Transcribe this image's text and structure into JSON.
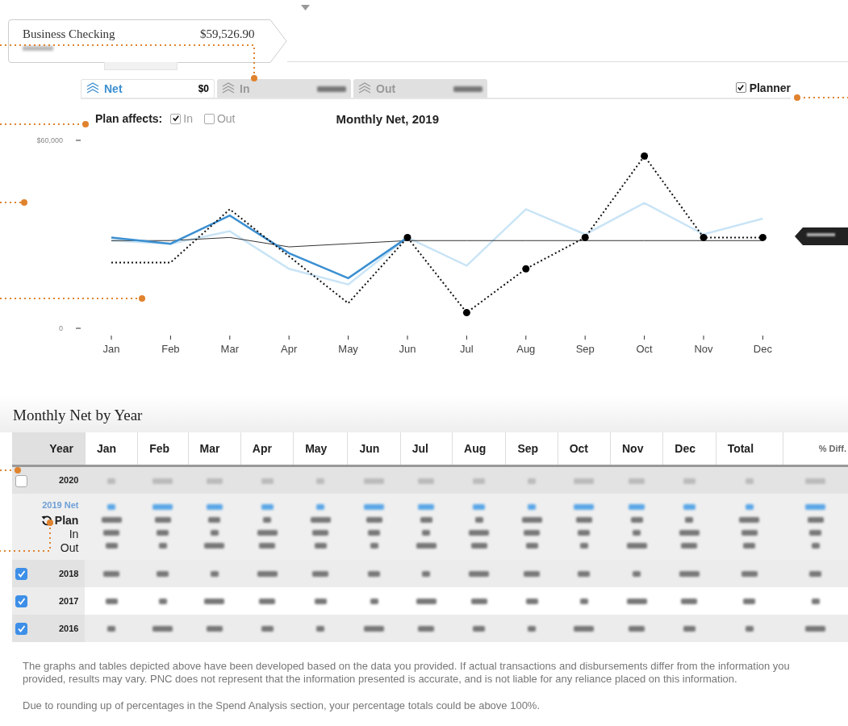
{
  "account": {
    "name": "Business Checking",
    "balance": "$59,526.90"
  },
  "tabs": [
    {
      "label": "Net",
      "amount": "$0",
      "selected": true
    },
    {
      "label": "In",
      "selected": false
    },
    {
      "label": "Out",
      "selected": false
    }
  ],
  "planner": {
    "label": "Planner",
    "checked": true
  },
  "plan_affects": {
    "label": "Plan affects:",
    "options": [
      {
        "label": "In",
        "checked": true
      },
      {
        "label": "Out",
        "checked": false
      }
    ]
  },
  "chart": {
    "chart_data": {
      "type": "line",
      "title": "Monthly Net, 2019",
      "categories": [
        "Jan",
        "Feb",
        "Mar",
        "Apr",
        "May",
        "Jun",
        "Jul",
        "Aug",
        "Sep",
        "Oct",
        "Nov",
        "Dec"
      ],
      "ylim": [
        0,
        60000
      ],
      "yticks": [
        {
          "value": 0,
          "label": "0"
        },
        {
          "value": 60000,
          "label": "$60,000"
        }
      ],
      "series": [
        {
          "color": "#111111",
          "line_style": "dotted",
          "values": [
            21000,
            21000,
            38000,
            23000,
            8000,
            29000,
            5000,
            19000,
            29000,
            55000,
            29000,
            29000
          ]
        },
        {
          "color": "#3b8fd1",
          "values": [
            29000,
            27000,
            36000,
            24000,
            16000,
            29000,
            null,
            null,
            null,
            null,
            null,
            null
          ]
        },
        {
          "color": "#c9e4f6",
          "values": [
            28000,
            27000,
            31000,
            19000,
            14000,
            29000,
            20000,
            38000,
            30000,
            40000,
            30000,
            35000
          ]
        },
        {
          "color": "#333333",
          "values": [
            28000,
            28000,
            29000,
            26000,
            27000,
            28000,
            28000,
            28000,
            28000,
            28000,
            28000,
            28000
          ]
        }
      ]
    }
  },
  "table": {
    "title": "Monthly Net by Year",
    "columns": [
      "Year",
      "Jan",
      "Feb",
      "Mar",
      "Apr",
      "May",
      "Jun",
      "Jul",
      "Aug",
      "Sep",
      "Oct",
      "Nov",
      "Dec",
      "Total",
      "% Diff."
    ],
    "rows": [
      {
        "kind": "year",
        "year": "2020",
        "checked": false
      },
      {
        "kind": "plan",
        "net_label": "2019 Net",
        "plan_label": "Plan",
        "in_label": "In",
        "out_label": "Out"
      },
      {
        "kind": "year",
        "year": "2018",
        "checked": true
      },
      {
        "kind": "year",
        "year": "2017",
        "checked": true
      },
      {
        "kind": "year",
        "year": "2016",
        "checked": true
      }
    ]
  },
  "disclaimers": [
    "The graphs and tables depicted above have been developed based on the data you provided. If actual transactions and disbursements differ from the information you provided, results may vary. PNC does not represent that the information presented is accurate, and is not liable for any reliance placed on this information.",
    "Due to rounding up of percentages in the Spend Analysis section, your percentage totals could be above 100%."
  ]
}
